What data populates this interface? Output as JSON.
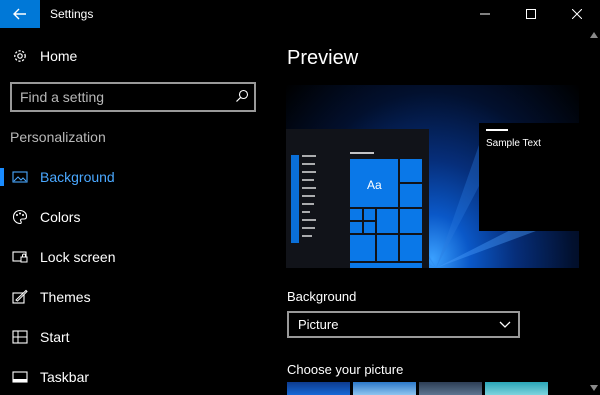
{
  "window": {
    "title": "Settings"
  },
  "sidebar": {
    "home_label": "Home",
    "search_placeholder": "Find a setting",
    "section_title": "Personalization",
    "items": [
      {
        "label": "Background",
        "icon": "picture-icon",
        "active": true
      },
      {
        "label": "Colors",
        "icon": "palette-icon",
        "active": false
      },
      {
        "label": "Lock screen",
        "icon": "lock-screen-icon",
        "active": false
      },
      {
        "label": "Themes",
        "icon": "themes-icon",
        "active": false
      },
      {
        "label": "Start",
        "icon": "start-icon",
        "active": false
      },
      {
        "label": "Taskbar",
        "icon": "taskbar-icon",
        "active": false
      }
    ]
  },
  "main": {
    "preview_title": "Preview",
    "preview_sample_text": "Sample Text",
    "preview_tile_text": "Aa",
    "background_label": "Background",
    "background_value": "Picture",
    "choose_picture_label": "Choose your picture"
  },
  "colors": {
    "accent": "#0078d7",
    "active_text": "#4aa8ff",
    "background": "#000000"
  }
}
